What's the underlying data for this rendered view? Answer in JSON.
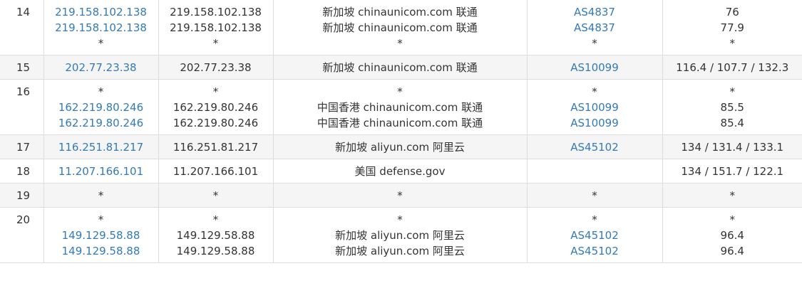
{
  "rows": [
    {
      "hop": "14",
      "shaded": false,
      "ip_links": [
        "219.158.102.138",
        "219.158.102.138",
        "*"
      ],
      "ips": [
        "219.158.102.138",
        "219.158.102.138",
        "*"
      ],
      "locations": [
        "新加坡 chinaunicom.com 联通",
        "新加坡 chinaunicom.com 联通",
        "*"
      ],
      "asns": [
        "AS4837",
        "AS4837",
        "*"
      ],
      "latencies": [
        "76",
        "77.9",
        "*"
      ]
    },
    {
      "hop": "15",
      "shaded": true,
      "ip_links": [
        "202.77.23.38"
      ],
      "ips": [
        "202.77.23.38"
      ],
      "locations": [
        "新加坡 chinaunicom.com 联通"
      ],
      "asns": [
        "AS10099"
      ],
      "latencies": [
        "116.4 / 107.7 / 132.3"
      ]
    },
    {
      "hop": "16",
      "shaded": false,
      "ip_links": [
        "*",
        "162.219.80.246",
        "162.219.80.246"
      ],
      "ips": [
        "*",
        "162.219.80.246",
        "162.219.80.246"
      ],
      "locations": [
        "*",
        "中国香港 chinaunicom.com 联通",
        "中国香港 chinaunicom.com 联通"
      ],
      "asns": [
        "*",
        "AS10099",
        "AS10099"
      ],
      "latencies": [
        "*",
        "85.5",
        "85.4"
      ]
    },
    {
      "hop": "17",
      "shaded": true,
      "ip_links": [
        "116.251.81.217"
      ],
      "ips": [
        "116.251.81.217"
      ],
      "locations": [
        "新加坡 aliyun.com 阿里云"
      ],
      "asns": [
        "AS45102"
      ],
      "latencies": [
        "134 / 131.4 / 133.1"
      ]
    },
    {
      "hop": "18",
      "shaded": false,
      "ip_links": [
        "11.207.166.101"
      ],
      "ips": [
        "11.207.166.101"
      ],
      "locations": [
        "美国 defense.gov"
      ],
      "asns": [
        ""
      ],
      "latencies": [
        "134 / 151.7 / 122.1"
      ]
    },
    {
      "hop": "19",
      "shaded": true,
      "ip_links": [
        "*"
      ],
      "ips": [
        "*"
      ],
      "locations": [
        "*"
      ],
      "asns": [
        "*"
      ],
      "latencies": [
        "*"
      ]
    },
    {
      "hop": "20",
      "shaded": false,
      "ip_links": [
        "*",
        "149.129.58.88",
        "149.129.58.88"
      ],
      "ips": [
        "*",
        "149.129.58.88",
        "149.129.58.88"
      ],
      "locations": [
        "*",
        "新加坡 aliyun.com 阿里云",
        "新加坡 aliyun.com 阿里云"
      ],
      "asns": [
        "*",
        "AS45102",
        "AS45102"
      ],
      "latencies": [
        "*",
        "96.4",
        "96.4"
      ]
    }
  ],
  "colors": {
    "link": "#337ab7",
    "text": "#333333",
    "row_shade": "#f5f5f5",
    "border": "#dddddd"
  }
}
